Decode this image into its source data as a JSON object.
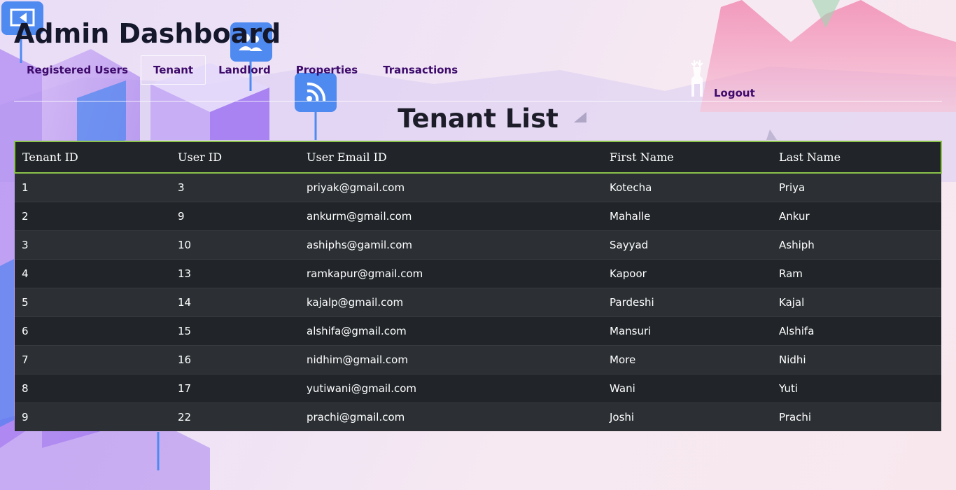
{
  "header": {
    "title": "Admin Dashboard"
  },
  "nav": {
    "items": [
      {
        "label": "Registered Users"
      },
      {
        "label": "Tenant",
        "active": true
      },
      {
        "label": "Landlord"
      },
      {
        "label": "Properties"
      },
      {
        "label": "Transactions"
      }
    ],
    "logout_label": "Logout"
  },
  "main": {
    "title": "Tenant List"
  },
  "table": {
    "columns": [
      "Tenant ID",
      "User ID",
      "User Email ID",
      "First Name",
      "Last Name"
    ],
    "rows": [
      [
        "1",
        "3",
        "priyak@gmail.com",
        "Kotecha",
        "Priya"
      ],
      [
        "2",
        "9",
        "ankurm@gmail.com",
        "Mahalle",
        "Ankur"
      ],
      [
        "3",
        "10",
        "ashiphs@gamil.com",
        "Sayyad",
        "Ashiph"
      ],
      [
        "4",
        "13",
        "ramkapur@gmail.com",
        "Kapoor",
        "Ram"
      ],
      [
        "5",
        "14",
        "kajalp@gmail.com",
        "Pardeshi",
        "Kajal"
      ],
      [
        "6",
        "15",
        "alshifa@gmail.com",
        "Mansuri",
        "Alshifa"
      ],
      [
        "7",
        "16",
        "nidhim@gmail.com",
        "More",
        "Nidhi"
      ],
      [
        "8",
        "17",
        "yutiwani@gmail.com",
        "Wani",
        "Yuti"
      ],
      [
        "9",
        "22",
        "prachi@gmail.com",
        "Joshi",
        "Prachi"
      ]
    ]
  },
  "icons": [
    "video-icon",
    "users-icon",
    "wifi-icon",
    "deer-icon"
  ],
  "colors": {
    "nav_text": "#3d0a6b",
    "table_bg": "#212529",
    "table_stripe": "#2c3034",
    "header_border": "#8bc34a"
  }
}
